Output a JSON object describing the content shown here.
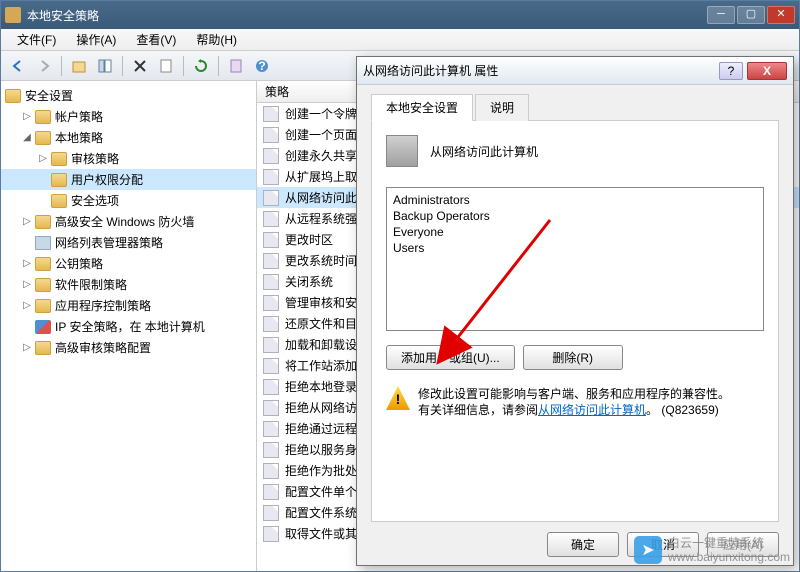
{
  "window": {
    "title": "本地安全策略"
  },
  "menu": {
    "file": "文件(F)",
    "action": "操作(A)",
    "view": "查看(V)",
    "help": "帮助(H)"
  },
  "tree": {
    "root": "安全设置",
    "nodes": [
      {
        "label": "帐户策略",
        "icon": "folder",
        "expand": "▷",
        "indent": 1
      },
      {
        "label": "本地策略",
        "icon": "folder",
        "expand": "◢",
        "indent": 1
      },
      {
        "label": "审核策略",
        "icon": "folder",
        "expand": "▷",
        "indent": 2
      },
      {
        "label": "用户权限分配",
        "icon": "folder",
        "expand": "",
        "indent": 2,
        "selected": true
      },
      {
        "label": "安全选项",
        "icon": "folder",
        "expand": "",
        "indent": 2
      },
      {
        "label": "高级安全 Windows 防火墙",
        "icon": "folder",
        "expand": "▷",
        "indent": 1
      },
      {
        "label": "网络列表管理器策略",
        "icon": "policy",
        "expand": "",
        "indent": 1
      },
      {
        "label": "公钥策略",
        "icon": "folder",
        "expand": "▷",
        "indent": 1
      },
      {
        "label": "软件限制策略",
        "icon": "folder",
        "expand": "▷",
        "indent": 1
      },
      {
        "label": "应用程序控制策略",
        "icon": "folder",
        "expand": "▷",
        "indent": 1
      },
      {
        "label": "IP 安全策略，在 本地计算机",
        "icon": "shield",
        "expand": "",
        "indent": 1
      },
      {
        "label": "高级审核策略配置",
        "icon": "folder",
        "expand": "▷",
        "indent": 1
      }
    ]
  },
  "list": {
    "header": "策略",
    "items": [
      "创建一个令牌",
      "创建一个页面",
      "创建永久共享",
      "从扩展坞上取",
      "从网络访问此",
      "从远程系统强",
      "更改时区",
      "更改系统时间",
      "关闭系统",
      "管理审核和安",
      "还原文件和目",
      "加载和卸载设",
      "将工作站添加",
      "拒绝本地登录",
      "拒绝从网络访",
      "拒绝通过远程",
      "拒绝以服务身",
      "拒绝作为批处",
      "配置文件单个",
      "配置文件系统",
      "取得文件或其"
    ],
    "selected_index": 4
  },
  "dialog": {
    "title": "从网络访问此计算机 属性",
    "tab1": "本地安全设置",
    "tab2": "说明",
    "prop_title": "从网络访问此计算机",
    "users": [
      "Administrators",
      "Backup Operators",
      "Everyone",
      "Users"
    ],
    "btn_add": "添加用户或组(U)...",
    "btn_remove": "删除(R)",
    "warning_line1": "修改此设置可能影响与客户端、服务和应用程序的兼容性。",
    "warning_line2_a": "有关详细信息，请参阅",
    "warning_link": "从网络访问此计算机",
    "warning_line2_b": "。 (Q823659)",
    "btn_ok": "确定",
    "btn_cancel": "取消",
    "btn_apply": "应用(A)"
  },
  "watermark": {
    "name": "白云一键重装系统",
    "url": "www.baiyunxitong.com"
  }
}
